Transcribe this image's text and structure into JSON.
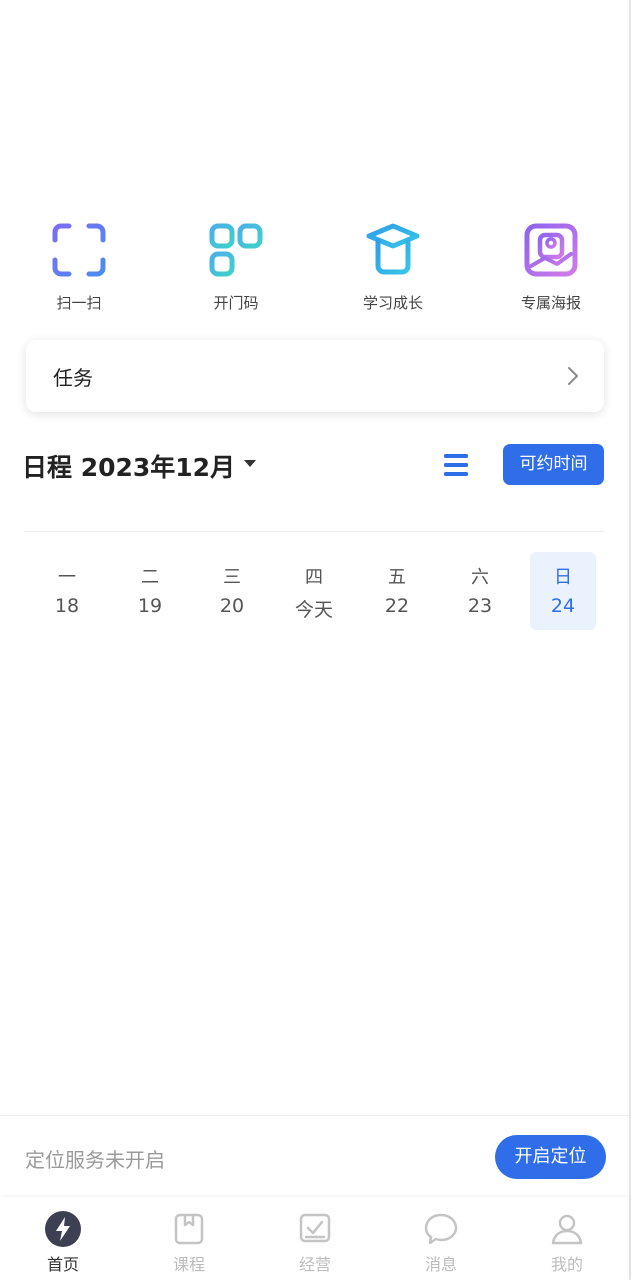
{
  "quick_actions": [
    {
      "label": "扫一扫",
      "icon": "scan-icon"
    },
    {
      "label": "开门码",
      "icon": "qr-code-icon"
    },
    {
      "label": "学习成长",
      "icon": "graduation-cap-icon"
    },
    {
      "label": "专属海报",
      "icon": "poster-image-icon"
    }
  ],
  "task": {
    "title": "任务"
  },
  "schedule": {
    "title": "日程 2023年12月",
    "available_button": "可约时间",
    "days": [
      {
        "weekday": "一",
        "date": "18"
      },
      {
        "weekday": "二",
        "date": "19"
      },
      {
        "weekday": "三",
        "date": "20"
      },
      {
        "weekday": "四",
        "date": "今天"
      },
      {
        "weekday": "五",
        "date": "22"
      },
      {
        "weekday": "六",
        "date": "23"
      },
      {
        "weekday": "日",
        "date": "24"
      }
    ],
    "selected_day": "24"
  },
  "location": {
    "status_text": "定位服务未开启",
    "enable_button": "开启定位"
  },
  "tabbar": {
    "tabs": [
      {
        "label": "首页",
        "icon": "lightning-icon"
      },
      {
        "label": "课程",
        "icon": "book-icon"
      },
      {
        "label": "经营",
        "icon": "checkbox-icon"
      },
      {
        "label": "消息",
        "icon": "chat-bubble-icon"
      },
      {
        "label": "我的",
        "icon": "person-icon"
      }
    ],
    "active": "首页"
  },
  "colors": {
    "accent": "#2f6ee8",
    "active_day_bg": "#eaf2fd",
    "muted_text": "#9a9a9a",
    "tab_inactive": "#bcbcbc"
  }
}
